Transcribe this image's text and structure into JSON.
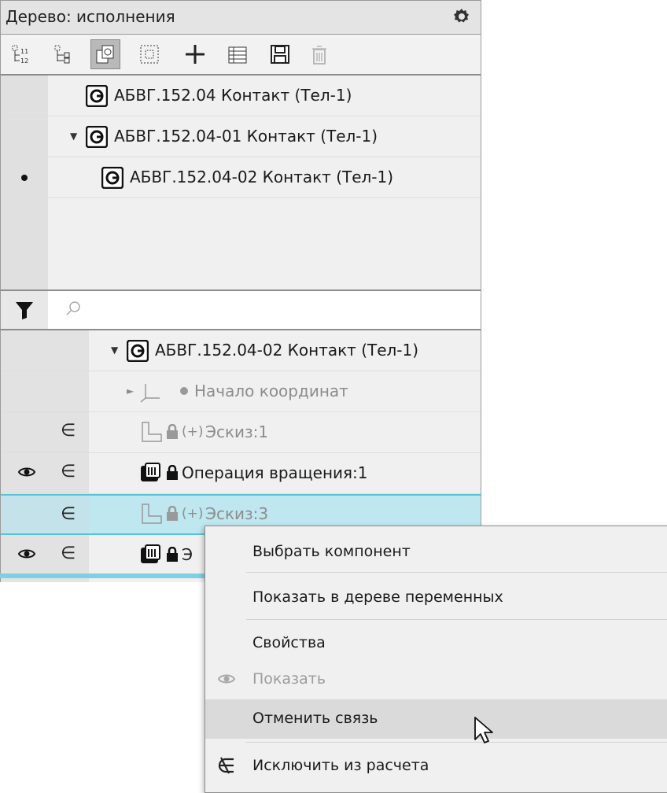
{
  "panel": {
    "title": "Дерево: исполнения",
    "toolbar": [
      "tree-numbered-icon",
      "tree-structure-icon",
      "copy-model-icon",
      "select-frame-icon",
      "add-icon",
      "table-icon",
      "save-icon",
      "delete-icon"
    ]
  },
  "executions": {
    "items": [
      {
        "label": "АБВГ.152.04 Контакт (Тел-1)",
        "level": 0,
        "active": false,
        "expanded": null
      },
      {
        "label": "АБВГ.152.04-01 Контакт (Тел-1)",
        "level": 0,
        "active": false,
        "expanded": true
      },
      {
        "label": "АБВГ.152.04-02 Контакт (Тел-1)",
        "level": 1,
        "active": true,
        "expanded": null
      }
    ]
  },
  "filter": {
    "search_placeholder": "",
    "search_value": ""
  },
  "tree": {
    "rows": [
      {
        "label": "АБВГ.152.04-02 Контакт (Тел-1)"
      },
      {
        "label": "Начало координат"
      },
      {
        "prefix": "(+)",
        "label": "Эскиз:1"
      },
      {
        "label": "Операция вращения:1"
      },
      {
        "prefix": "(+)",
        "label": "Эскиз:3"
      },
      {
        "label": "Э"
      }
    ]
  },
  "context_menu": {
    "items": [
      {
        "label": "Выбрать компонент",
        "disabled": false
      },
      {
        "label": "Показать в дереве переменных",
        "disabled": false
      },
      {
        "label": "Свойства",
        "disabled": false
      },
      {
        "label": "Показать",
        "disabled": true
      },
      {
        "label": "Отменить связь",
        "disabled": false,
        "hovered": true
      },
      {
        "label": "Исключить из расчета",
        "disabled": false
      }
    ]
  },
  "colors": {
    "selection": "#bfe7ef",
    "selection_border": "#57c4dc",
    "menu_hover": "#dadada"
  }
}
